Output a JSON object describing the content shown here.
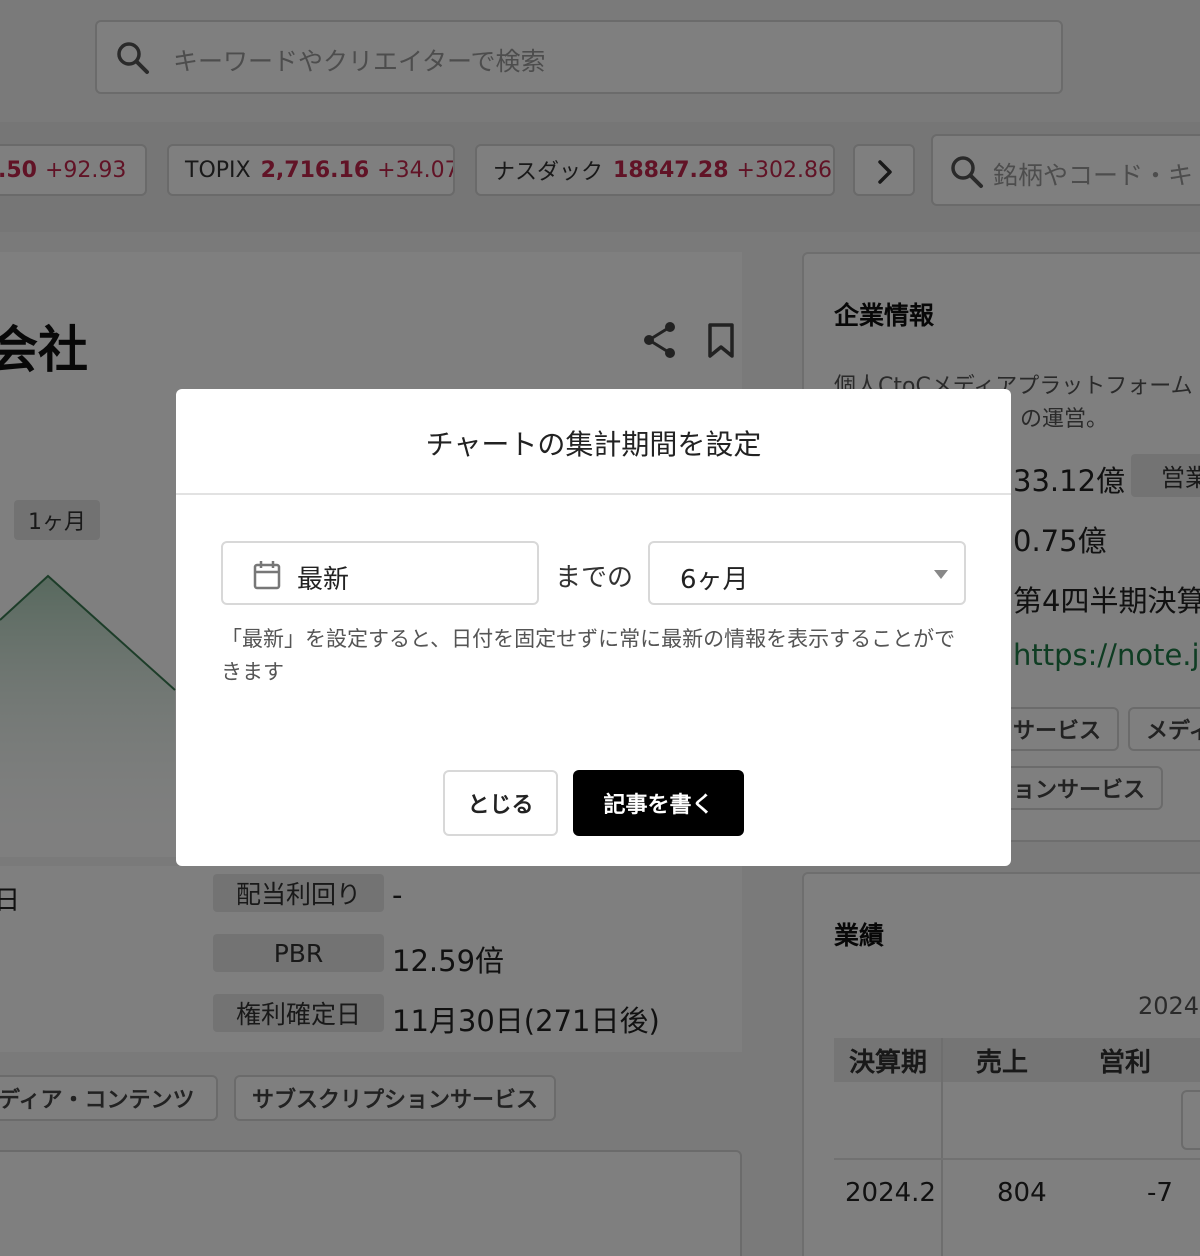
{
  "search": {
    "placeholder": "キーワードやクリエイターで検索"
  },
  "tickers": [
    {
      "name": "",
      "price": ".50",
      "change": "+92.93"
    },
    {
      "name": "TOPIX",
      "price": "2,716.16",
      "change": "+34.07"
    },
    {
      "name": "ナスダック",
      "price": "18847.28",
      "change": "+302.86"
    }
  ],
  "stock_search": {
    "placeholder": "銘柄やコード・キ"
  },
  "company": {
    "title_fragment": "会社"
  },
  "chart": {
    "period_chip": "1ヶ月"
  },
  "details": {
    "row_fragment": "日",
    "dividend_label": "配当利回り",
    "dividend_value": "-",
    "pbr_label": "PBR",
    "pbr_value": "12.59倍",
    "record_label": "権利確定日",
    "record_value": "11月30日(271日後)"
  },
  "tags": [
    "ディア・コンテンツ",
    "サブスクリプションサービス"
  ],
  "company_info": {
    "heading": "企業情報",
    "desc_line1": "個人CtoCメディアプラットフォーム",
    "desc_line2": "の運営。",
    "value1": "33.12億",
    "chip1": "営業",
    "value2": "0.75億",
    "value3": "第4四半期決算",
    "link": "https://note.jp",
    "tag1": "サービス",
    "tag2": "メディ",
    "tag3": "ョンサービス"
  },
  "performance": {
    "heading": "業績",
    "year_label": "2024",
    "headers": [
      "決算期",
      "売上",
      "営利"
    ],
    "rows": [
      {
        "period": "2024.2",
        "sales": "804",
        "op": "-7"
      }
    ]
  },
  "modal": {
    "title": "チャートの集計期間を設定",
    "date_value": "最新",
    "made_label": "までの",
    "period_value": "6ヶ月",
    "help_text": "「最新」を設定すると、日付を固定せずに常に最新の情報を表示することができます",
    "close_label": "とじる",
    "write_label": "記事を書く"
  },
  "colors": {
    "price_red": "#c2274d",
    "link_green": "#1f7a46",
    "chart_green": "#3a7a52"
  }
}
